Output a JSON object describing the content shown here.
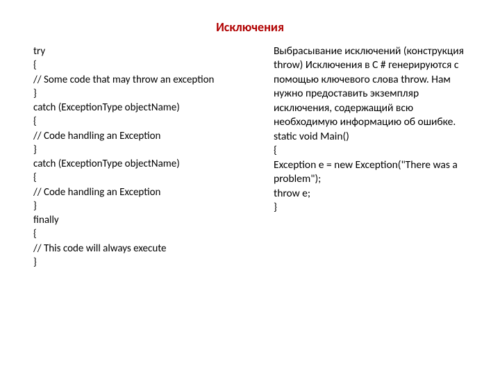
{
  "title": "Исключения",
  "left_code": "try\n{\n// Some code that may throw an exception\n}\ncatch (ExceptionType objectName)\n{\n// Code handling an Exception\n}\ncatch (ExceptionType objectName)\n{\n// Code handling an Exception\n}\nfinally\n{\n// This code will always execute\n}",
  "right_text": "Выбрасывание исключений (конструкция throw) Исключения в C # генерируются с помощью ключевого слова throw. Нам нужно предоставить экземпляр исключения, содержащий всю необходимую информацию об ошибке.\nstatic void Main()\n{\nException e = new Exception(\"There was a problem\");\nthrow e;\n}"
}
